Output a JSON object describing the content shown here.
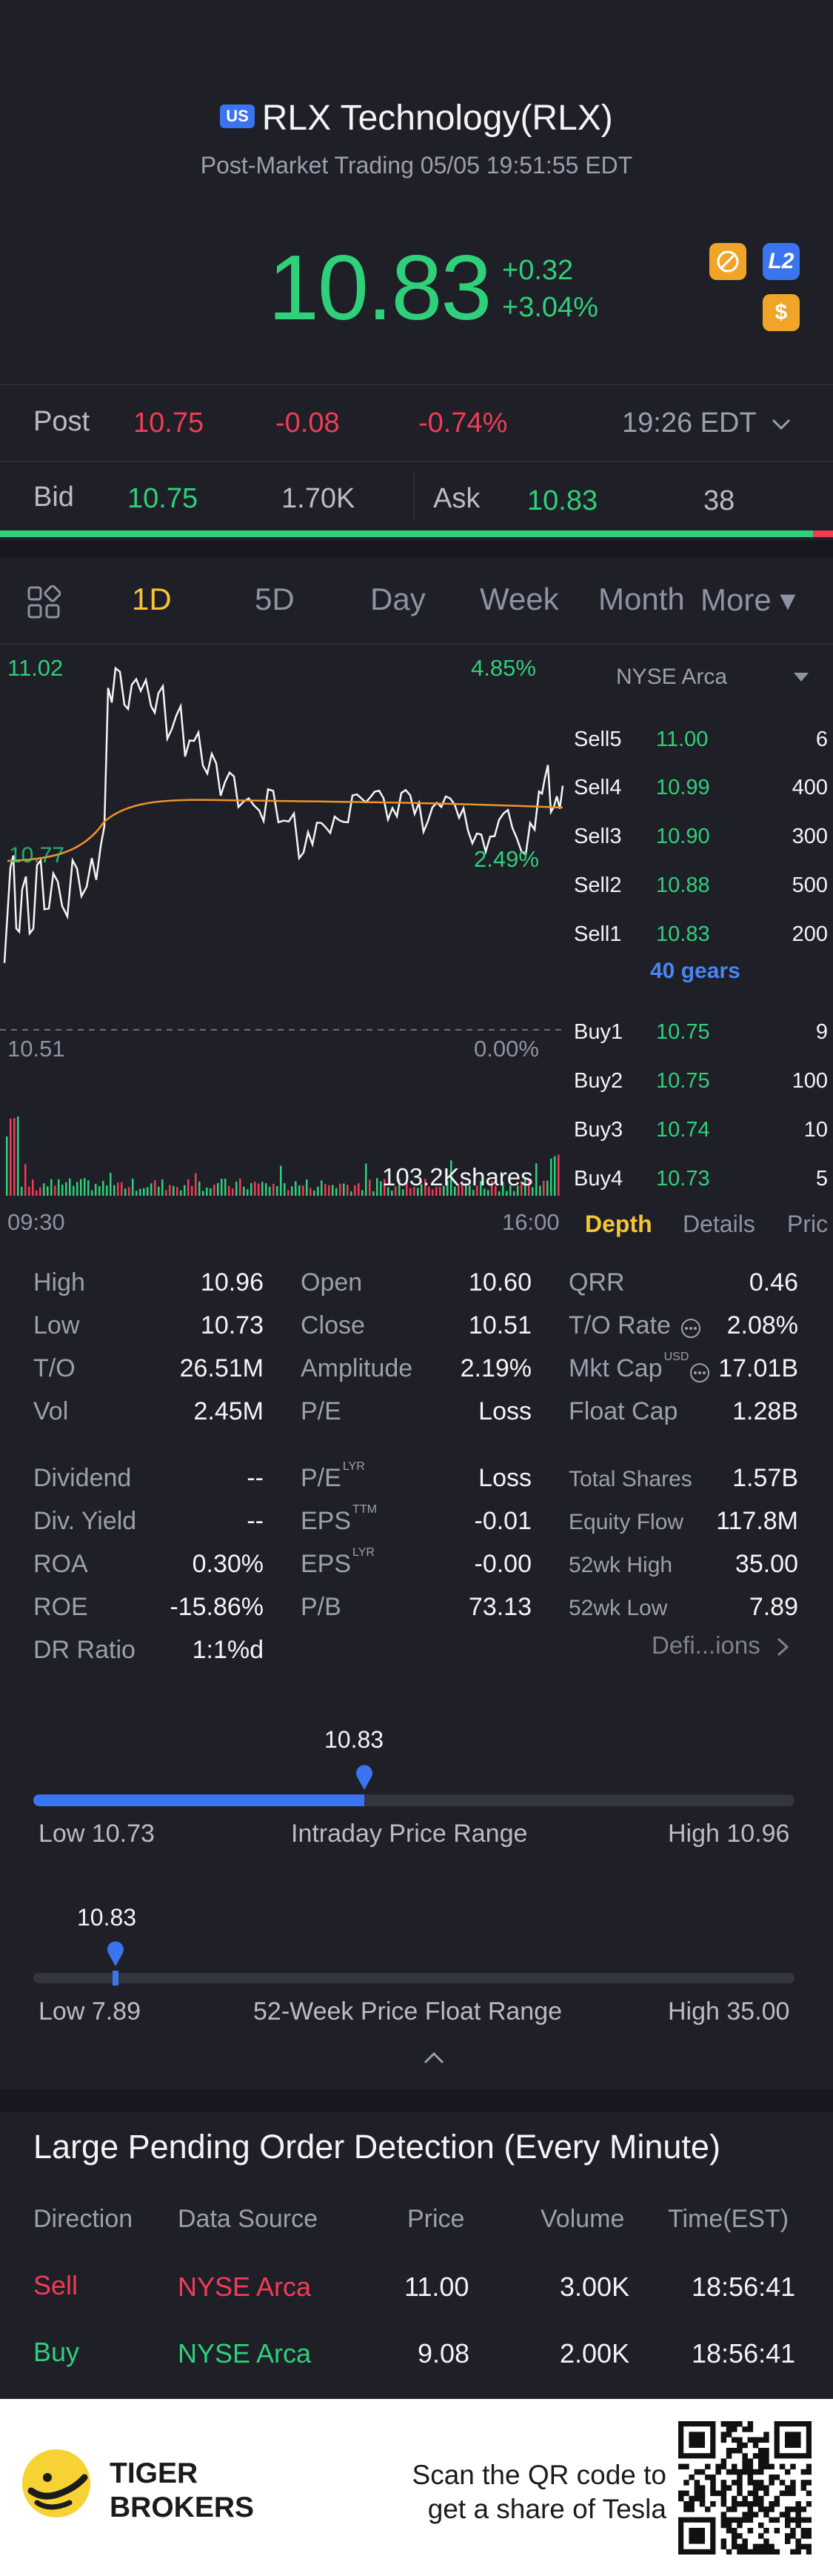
{
  "header": {
    "market_flag": "US",
    "title": "RLX Technology(RLX)",
    "subtitle": "Post-Market Trading 05/05 19:51:55 EDT",
    "price": "10.83",
    "change_abs": "+0.32",
    "change_pct": "+3.04%",
    "badge_l2": "L2",
    "badge_dollar": "$"
  },
  "post": {
    "label": "Post",
    "price": "10.75",
    "change": "-0.08",
    "pct": "-0.74%",
    "time": "19:26 EDT"
  },
  "bidask": {
    "bid_label": "Bid",
    "bid_price": "10.75",
    "bid_size": "1.70K",
    "ask_label": "Ask",
    "ask_price": "10.83",
    "ask_size": "38"
  },
  "tabs": [
    "1D",
    "5D",
    "Day",
    "Week",
    "Month",
    "More ▾"
  ],
  "chart": {
    "high_label": "11.02",
    "high_pct": "4.85%",
    "low_label": "10.51",
    "low_pct": "0.00%",
    "avg_label": "10.77",
    "cur_pct": "2.49%",
    "volume_label": "103.2Kshares",
    "time_start": "09:30",
    "time_end": "16:00"
  },
  "orderbook": {
    "exchange": "NYSE Arca",
    "gears": "40 gears",
    "sells": [
      {
        "label": "Sell5",
        "price": "11.00",
        "vol": "6"
      },
      {
        "label": "Sell4",
        "price": "10.99",
        "vol": "400"
      },
      {
        "label": "Sell3",
        "price": "10.90",
        "vol": "300"
      },
      {
        "label": "Sell2",
        "price": "10.88",
        "vol": "500"
      },
      {
        "label": "Sell1",
        "price": "10.83",
        "vol": "200"
      }
    ],
    "buys": [
      {
        "label": "Buy1",
        "price": "10.75",
        "vol": "9"
      },
      {
        "label": "Buy2",
        "price": "10.75",
        "vol": "100"
      },
      {
        "label": "Buy3",
        "price": "10.74",
        "vol": "10"
      },
      {
        "label": "Buy4",
        "price": "10.73",
        "vol": "5"
      }
    ],
    "tab_depth": "Depth",
    "tab_details": "Details",
    "tab_price": "Pric"
  },
  "stats": {
    "col1": [
      {
        "label": "High",
        "value": "10.96"
      },
      {
        "label": "Low",
        "value": "10.73"
      },
      {
        "label": "T/O",
        "value": "26.51M"
      },
      {
        "label": "Vol",
        "value": "2.45M"
      }
    ],
    "col2": [
      {
        "label": "Open",
        "value": "10.60"
      },
      {
        "label": "Close",
        "value": "10.51"
      },
      {
        "label": "Amplitude",
        "value": "2.19%"
      },
      {
        "label": "P/E",
        "value": "Loss"
      }
    ],
    "col3": [
      {
        "label": "QRR",
        "value": "0.46"
      },
      {
        "label": "T/O Rate",
        "value": "2.08%"
      },
      {
        "label": "Mkt Cap",
        "value": "17.01B",
        "sup": "USD"
      },
      {
        "label": "Float Cap",
        "value": "1.28B"
      }
    ],
    "col1b": [
      {
        "label": "Dividend",
        "value": "--"
      },
      {
        "label": "Div. Yield",
        "value": "--"
      },
      {
        "label": "ROA",
        "value": "0.30%"
      },
      {
        "label": "ROE",
        "value": "-15.86%"
      },
      {
        "label": "DR Ratio",
        "value": "1:1%d"
      }
    ],
    "col2b": [
      {
        "label": "P/E",
        "sup": "LYR",
        "value": "Loss"
      },
      {
        "label": "EPS",
        "sup": "TTM",
        "value": "-0.01"
      },
      {
        "label": "EPS",
        "sup": "LYR",
        "value": "-0.00"
      },
      {
        "label": "P/B",
        "value": "73.13"
      }
    ],
    "col3b": [
      {
        "label": "Total Shares",
        "value": "1.57B"
      },
      {
        "label": "Equity Flow",
        "value": "117.8M"
      },
      {
        "label": "52wk High",
        "value": "35.00"
      },
      {
        "label": "52wk Low",
        "value": "7.89"
      }
    ],
    "definitions": "Defi...ions"
  },
  "intraday": {
    "current": "10.83",
    "low": "Low 10.73",
    "title": "Intraday Price Range",
    "high": "High 10.96",
    "fill_fraction": 0.435
  },
  "week52": {
    "current": "10.83",
    "low": "Low 7.89",
    "title": "52-Week Price Float Range",
    "high": "High 35.00",
    "fill_fraction": 0.108
  },
  "pending": {
    "title": "Large Pending Order Detection (Every Minute)",
    "headers": [
      "Direction",
      "Data Source",
      "Price",
      "Volume",
      "Time(EST)"
    ],
    "rows": [
      {
        "direction": "Sell",
        "source": "NYSE Arca",
        "price": "11.00",
        "volume": "3.00K",
        "time": "18:56:41"
      },
      {
        "direction": "Buy",
        "source": "NYSE Arca",
        "price": "9.08",
        "volume": "2.00K",
        "time": "18:56:41"
      }
    ]
  },
  "footer": {
    "brand_line1": "TIGER",
    "brand_line2": "BROKERS",
    "cta_line1": "Scan the QR code to",
    "cta_line2": "get a share of Tesla"
  },
  "colors": {
    "up": "#2fd07a",
    "down": "#f23c55",
    "accent_blue": "#3a74ee",
    "accent_yellow": "#f6c535",
    "background": "#1e1f27"
  }
}
